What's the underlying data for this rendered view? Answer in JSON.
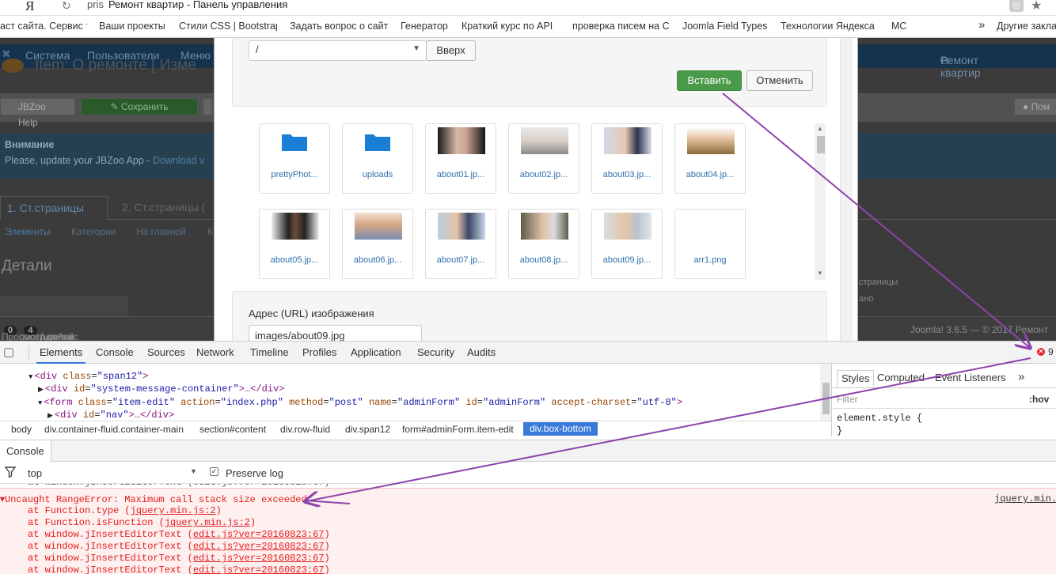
{
  "browser": {
    "url_prefix": "pris",
    "tab_title": "Ремонт квартир - Панель управления",
    "search_logo": "Я",
    "bookmarks": [
      "аст сайта. Сервис т",
      "Ваши проекты",
      "Стили CSS | Bootstrap",
      "Задать вопрос о сайт",
      "Генератор",
      "Краткий курс по API",
      "проверка писем на С",
      "Joomla Field Types",
      "Технологии Яндекса",
      "MC"
    ],
    "more_bookmarks": "»",
    "other_bookmarks": "Другие закла"
  },
  "background_page": {
    "nav_items": [
      "Система",
      "Пользователи",
      "Меню"
    ],
    "brand_link": "Ремонт квартир",
    "page_title": "Item: О ремонте [ Изме",
    "toolbar": {
      "help": "JBZoo Help",
      "save": "Сохранить",
      "right_help": "Пом"
    },
    "warning": {
      "title": "Внимание",
      "message": "Please, update your JBZoo App -",
      "link": "Download v"
    },
    "tabs": [
      "1. Ст.страницы",
      "2. Ст.страницы ("
    ],
    "subtabs": [
      "Элементы",
      "Категории",
      "На главной",
      "К"
    ],
    "details_heading": "Детали",
    "side_texts": [
      "страницы",
      "ано"
    ],
    "footer": {
      "view_site": "Просмотр сайта",
      "visitors_count": "0",
      "visitors_label": "посетителей",
      "admins_count": "4",
      "admins_label": "Админис",
      "version": "Joomla! 3.6.5 — © 2017 Ремонт"
    }
  },
  "modal": {
    "folder_select_value": "/",
    "up_button": "Вверх",
    "insert_button": "Вставить",
    "cancel_button": "Отменить",
    "files": [
      {
        "name": "prettyPhot...",
        "kind": "folder"
      },
      {
        "name": "uploads",
        "kind": "folder"
      },
      {
        "name": "about01.jp...",
        "kind": "image"
      },
      {
        "name": "about02.jp...",
        "kind": "image"
      },
      {
        "name": "about03.jp...",
        "kind": "image"
      },
      {
        "name": "about04.jp...",
        "kind": "image"
      },
      {
        "name": "about05.jp...",
        "kind": "image"
      },
      {
        "name": "about06.jp...",
        "kind": "image"
      },
      {
        "name": "about07.jp...",
        "kind": "image"
      },
      {
        "name": "about08.jp...",
        "kind": "image"
      },
      {
        "name": "about09.jp...",
        "kind": "image"
      },
      {
        "name": "arr1.png",
        "kind": "image"
      }
    ],
    "url_label": "Адрес (URL) изображения",
    "url_value": "images/about09.jpg"
  },
  "devtools": {
    "tabs": [
      "Elements",
      "Console",
      "Sources",
      "Network",
      "Timeline",
      "Profiles",
      "Application",
      "Security",
      "Audits"
    ],
    "active_tab": "Elements",
    "error_count": "9",
    "dom_lines": [
      {
        "indent": 0,
        "tag": "div",
        "attrs": [
          [
            "class",
            "span12"
          ]
        ],
        "tail": ">"
      },
      {
        "indent": 1,
        "tag": "div",
        "attrs": [
          [
            "id",
            "system-message-container"
          ]
        ],
        "tail": ">…</div>"
      },
      {
        "indent": 1,
        "tag": "form",
        "attrs": [
          [
            "class",
            "item-edit"
          ],
          [
            "action",
            "index.php"
          ],
          [
            "method",
            "post"
          ],
          [
            "name",
            "adminForm"
          ],
          [
            "id",
            "adminForm"
          ],
          [
            "accept-charset",
            "utf-8"
          ]
        ],
        "tail": ">"
      },
      {
        "indent": 2,
        "tag": "div",
        "attrs": [
          [
            "id",
            "nav"
          ]
        ],
        "tail": ">…</div>"
      }
    ],
    "breadcrumbs": [
      "body",
      "div.container-fluid.container-main",
      "section#content",
      "div.row-fluid",
      "div.span12",
      "form#adminForm.item-edit",
      "div.box-bottom"
    ],
    "styles_tabs": [
      "Styles",
      "Computed",
      "Event Listeners",
      "»"
    ],
    "styles_filter": "Filter",
    "styles_hov": ":hov",
    "styles_rule": "element.style {",
    "styles_rule_end": "}",
    "drawer_tab": "Console",
    "console_context": "top",
    "preserve_log": "Preserve log",
    "error_message": "Uncaught RangeError: Maximum call stack size exceeded",
    "error_source": "jquery.min.",
    "stack": [
      {
        "fn": "at Function.type",
        "src": "jquery.min.js:2"
      },
      {
        "fn": "at Function.isFunction",
        "src": "jquery.min.js:2"
      },
      {
        "fn": "at window.jInsertEditorText",
        "src": "edit.js?ver=20160823:67"
      },
      {
        "fn": "at window.jInsertEditorText",
        "src": "edit.js?ver=20160823:67"
      },
      {
        "fn": "at window.jInsertEditorText",
        "src": "edit.js?ver=20160823:67"
      },
      {
        "fn": "at window.jInsertEditorText",
        "src": "edit.js?ver=20160823:67"
      }
    ]
  },
  "colors": {
    "accent": "#3879d9",
    "error": "#e21b1b",
    "insert": "#4a9a4a",
    "annotation": "#8e44ad"
  }
}
